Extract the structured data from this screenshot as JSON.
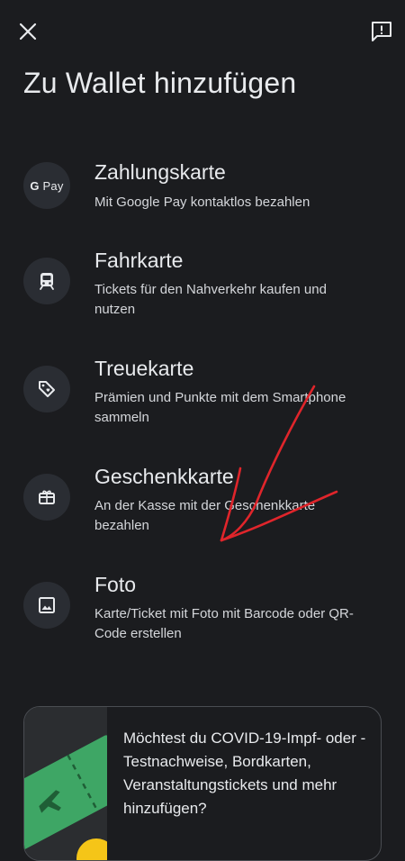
{
  "header": {
    "title": "Zu Wallet hinzufügen",
    "close_icon": "close-icon",
    "feedback_icon": "feedback-icon"
  },
  "options": [
    {
      "icon": "google-pay-icon",
      "icon_text": "Pay",
      "title": "Zahlungskarte",
      "description": "Mit Google Pay kontaktlos bezahlen"
    },
    {
      "icon": "train-icon",
      "title": "Fahrkarte",
      "description": "Tickets für den Nahverkehr kaufen und nutzen"
    },
    {
      "icon": "loyalty-tag-icon",
      "title": "Treuekarte",
      "description": "Prämien und Punkte mit dem Smartphone sammeln"
    },
    {
      "icon": "gift-card-icon",
      "title": "Geschenkkarte",
      "description": "An der Kasse mit der Geschenkkarte bezahlen"
    },
    {
      "icon": "photo-icon",
      "title": "Foto",
      "description": "Karte/Ticket mit Foto mit Barcode oder QR-Code erstellen"
    }
  ],
  "promo": {
    "text": "Möchtest du COVID-19-Impf- oder -Testnachweise, Bordkarten, Veranstaltungstickets und mehr hinzufügen?",
    "image": "ticket-illustration"
  },
  "colors": {
    "background": "#1b1c1f",
    "icon_circle": "#2a2d33",
    "text_primary": "#e8eaed",
    "annotation_red": "#e0252b",
    "ticket_green": "#3ea665"
  }
}
